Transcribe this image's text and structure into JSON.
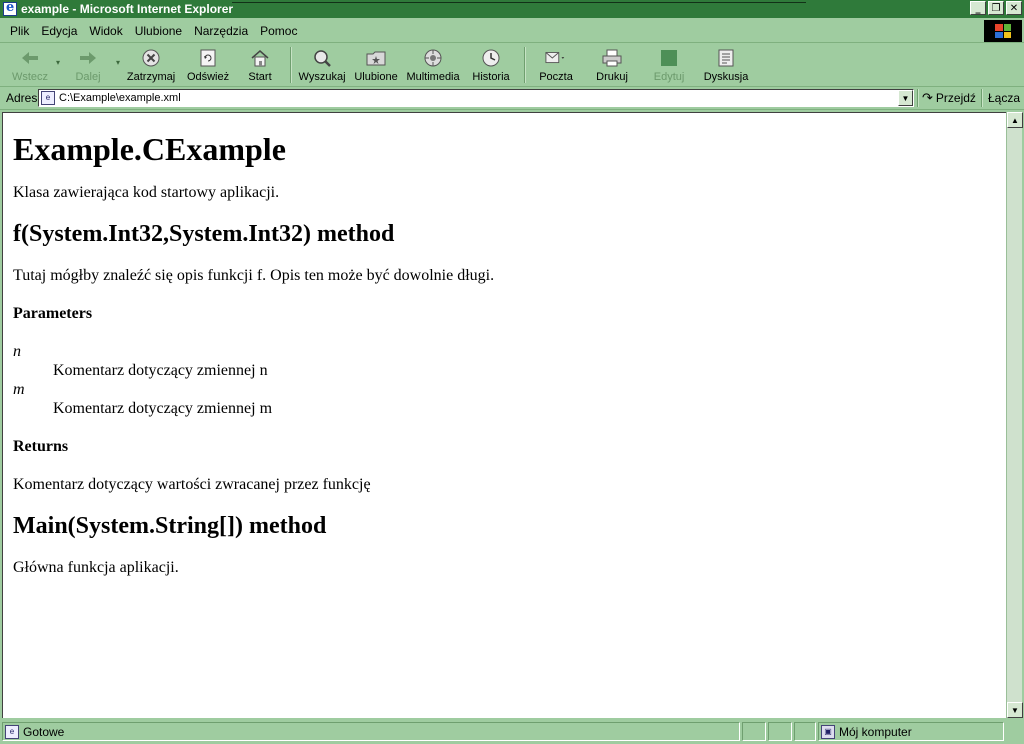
{
  "window": {
    "title": "example - Microsoft Internet Explorer",
    "controls": {
      "minimize": "_",
      "maximize": "❐",
      "close": "✕"
    }
  },
  "menu": [
    {
      "label": "Plik"
    },
    {
      "label": "Edycja"
    },
    {
      "label": "Widok"
    },
    {
      "label": "Ulubione"
    },
    {
      "label": "Narzędzia"
    },
    {
      "label": "Pomoc"
    }
  ],
  "toolbar": {
    "back": "Wstecz",
    "forward": "Dalej",
    "stop": "Zatrzymaj",
    "refresh": "Odśwież",
    "home": "Start",
    "search": "Wyszukaj",
    "favorites": "Ulubione",
    "media": "Multimedia",
    "history": "Historia",
    "mail": "Poczta",
    "print": "Drukuj",
    "edit": "Edytuj",
    "discuss": "Dyskusja"
  },
  "address": {
    "label": "Adres",
    "value": "C:\\Example\\example.xml",
    "go": "Przejdź",
    "links": "Łącza"
  },
  "document": {
    "title": "Example.CExample",
    "class_desc": "Klasa zawierająca kod startowy aplikacji.",
    "method1": {
      "heading": "f(System.Int32,System.Int32) method",
      "desc": "Tutaj mógłby znaleźć się opis funkcji f. Opis ten może być dowolnie długi.",
      "params_heading": "Parameters",
      "params": [
        {
          "name": "n",
          "desc": "Komentarz dotyczący zmiennej n"
        },
        {
          "name": "m",
          "desc": "Komentarz dotyczący zmiennej m"
        }
      ],
      "returns_heading": "Returns",
      "returns_desc": "Komentarz dotyczący wartości zwracanej przez funkcję"
    },
    "method2": {
      "heading": "Main(System.String[]) method",
      "desc": "Główna funkcja aplikacji."
    }
  },
  "status": {
    "text": "Gotowe",
    "zone": "Mój komputer"
  },
  "colors": {
    "chrome": "#9fcca0",
    "titlebar": "#2f7a3a"
  }
}
